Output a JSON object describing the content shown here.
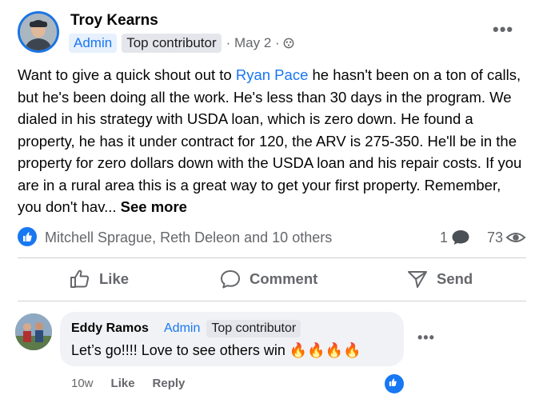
{
  "post": {
    "author": "Troy Kearns",
    "badges": {
      "admin": "Admin",
      "top": "Top contributor"
    },
    "date": "· May 2 ·",
    "text_start": "Want to give a quick shout out to ",
    "mention": "Ryan Pace",
    "text_rest": " he hasn't been on a ton of calls, but he's been doing all the work.  He's less than 30 days in the program.  We dialed in his strategy with USDA loan, which is zero down.  He found a property, he has it under contract for 120, the ARV is 275-350.  He'll be in the property for zero dollars down with the USDA loan and his repair costs.  If you are in a rural area this is a great way to get your first property.  Remember, you don't hav... ",
    "see_more": "See more",
    "reactors": "Mitchell Sprague, Reth Deleon and 10 others",
    "comment_count": "1",
    "view_count": "73"
  },
  "actions": {
    "like": "Like",
    "comment": "Comment",
    "send": "Send"
  },
  "comment": {
    "author": "Eddy Ramos",
    "badges": {
      "admin": "Admin",
      "top": "Top contributor"
    },
    "text": "Let’s go!!!! Love to see others win 🔥🔥🔥🔥",
    "time": "10w",
    "like": "Like",
    "reply": "Reply"
  },
  "colors": {
    "accent": "#1877f2",
    "muted": "#65676b",
    "bubble": "#f0f2f5"
  }
}
